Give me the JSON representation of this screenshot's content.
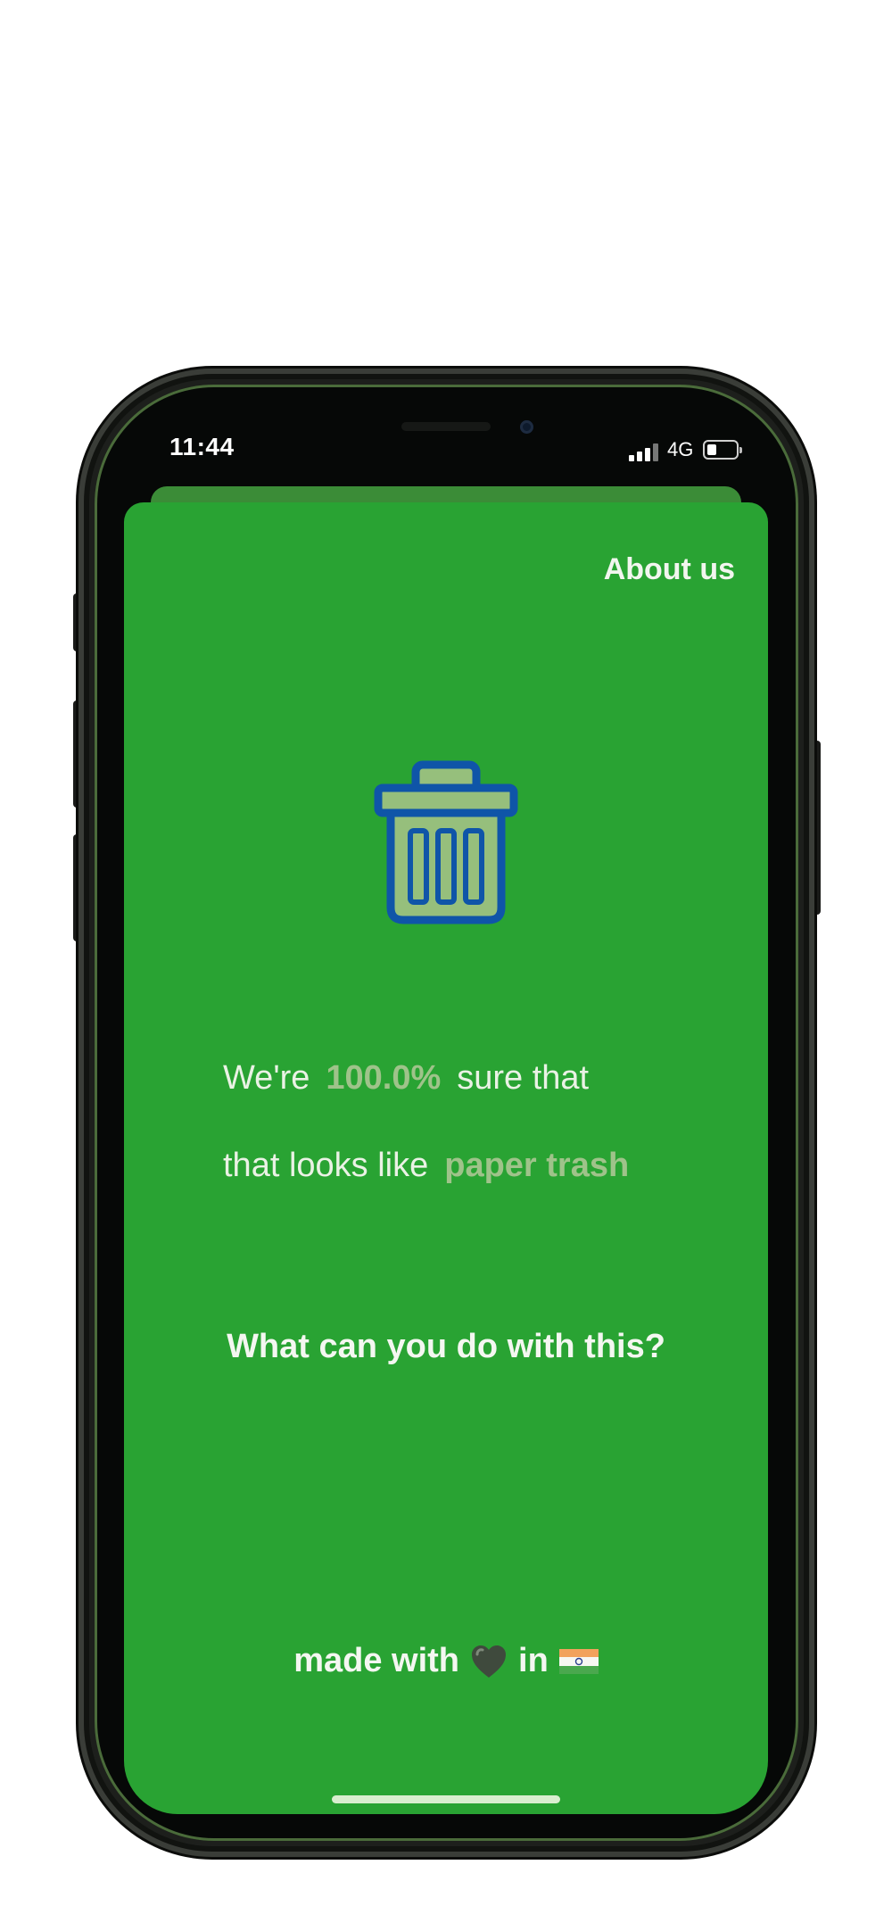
{
  "status_bar": {
    "time": "11:44",
    "network": "4G",
    "signal_icon": "cellular-signal-icon",
    "battery_icon": "battery-icon"
  },
  "header": {
    "about_label": "About us"
  },
  "result": {
    "icon": "trash-bin-icon",
    "prefix": "We're",
    "confidence": "100.0%",
    "suffix": "sure that",
    "line2_prefix": "that looks like",
    "category": "paper trash"
  },
  "question": "What can you do with this?",
  "footer": {
    "made_with": "made with",
    "heart_icon": "heart-emoji-icon",
    "in": "in",
    "flag_icon": "india-flag-icon"
  },
  "colors": {
    "background": "#29a333",
    "highlight": "#9fc38a",
    "icon_stroke": "#0f55a8",
    "icon_fill": "#96bf7c"
  }
}
